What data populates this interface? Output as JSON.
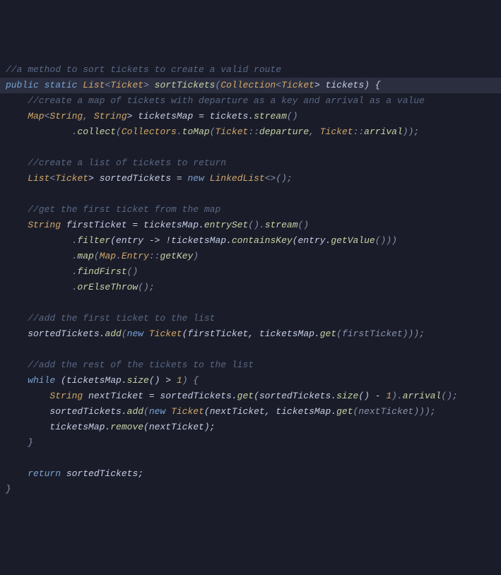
{
  "code": {
    "l1": "//a method to sort tickets to create a valid route",
    "l2a": "public static ",
    "l2b": "List",
    "l2c": "<",
    "l2d": "Ticket",
    "l2e": "> ",
    "l2f": "sortTickets",
    "l2g": "(",
    "l2h": "Collection",
    "l2i": "<",
    "l2j": "Ticket",
    "l2k": "> tickets) {",
    "l3": "    //create a map of tickets with departure as a key and arrival as a value",
    "l4a": "    Map",
    "l4b": "<",
    "l4c": "String",
    "l4d": ", ",
    "l4e": "String",
    "l4f": "> ticketsMap = tickets.",
    "l4g": "stream",
    "l4h": "()",
    "l5a": "            .",
    "l5b": "collect",
    "l5c": "(",
    "l5d": "Collectors",
    "l5e": ".",
    "l5f": "toMap",
    "l5g": "(",
    "l5h": "Ticket",
    "l5i": "::",
    "l5j": "departure",
    "l5k": ", ",
    "l5l": "Ticket",
    "l5m": "::",
    "l5n": "arrival",
    "l5o": "));",
    "l6": "",
    "l7": "    //create a list of tickets to return",
    "l8a": "    List",
    "l8b": "<",
    "l8c": "Ticket",
    "l8d": "> sortedTickets = ",
    "l8e": "new ",
    "l8f": "LinkedList",
    "l8g": "<>();",
    "l9": "",
    "l10": "    //get the first ticket from the map",
    "l11a": "    String",
    "l11b": " firstTicket = ticketsMap.",
    "l11c": "entrySet",
    "l11d": "().",
    "l11e": "stream",
    "l11f": "()",
    "l12a": "            .",
    "l12b": "filter",
    "l12c": "(entry -> !ticketsMap.",
    "l12d": "containsKey",
    "l12e": "(entry.",
    "l12f": "getValue",
    "l12g": "()))",
    "l13a": "            .",
    "l13b": "map",
    "l13c": "(",
    "l13d": "Map",
    "l13e": ".",
    "l13f": "Entry",
    "l13g": "::",
    "l13h": "getKey",
    "l13i": ")",
    "l14a": "            .",
    "l14b": "findFirst",
    "l14c": "()",
    "l15a": "            .",
    "l15b": "orElseThrow",
    "l15c": "();",
    "l16": "",
    "l17": "    //add the first ticket to the list",
    "l18a": "    sortedTickets.",
    "l18b": "add",
    "l18c": "(",
    "l18d": "new ",
    "l18e": "Ticket",
    "l18f": "(firstTicket, ticketsMap.",
    "l18g": "get",
    "l18h": "(firstTicket)));",
    "l19": "",
    "l20": "    //add the rest of the tickets to the list",
    "l21a": "    while ",
    "l21b": "(ticketsMap.",
    "l21c": "size",
    "l21d": "() > ",
    "l21e": "1",
    "l21f": ") {",
    "l22a": "        String",
    "l22b": " nextTicket = sortedTickets.",
    "l22c": "get",
    "l22d": "(sortedTickets.",
    "l22e": "size",
    "l22f": "() - ",
    "l22g": "1",
    "l22h": ").",
    "l22i": "arrival",
    "l22j": "();",
    "l23a": "        sortedTickets.",
    "l23b": "add",
    "l23c": "(",
    "l23d": "new ",
    "l23e": "Ticket",
    "l23f": "(nextTicket, ticketsMap.",
    "l23g": "get",
    "l23h": "(nextTicket)));",
    "l24a": "        ticketsMap.",
    "l24b": "remove",
    "l24c": "(nextTicket);",
    "l25": "    }",
    "l26": "",
    "l27a": "    return ",
    "l27b": "sortedTickets;",
    "l28": "}"
  }
}
